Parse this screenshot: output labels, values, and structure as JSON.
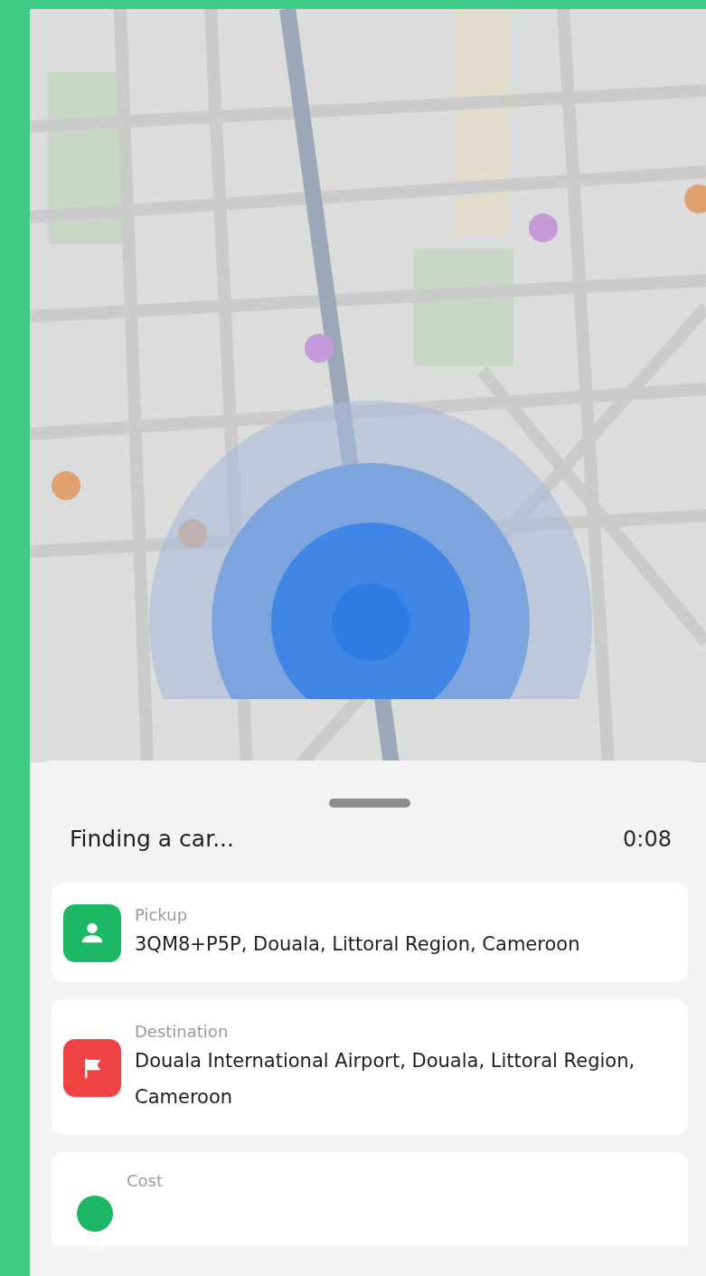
{
  "sheet": {
    "title": "Finding a car...",
    "timer": "0:08"
  },
  "locations": [
    {
      "kind": "pickup",
      "color": "#1db866",
      "label": "Pickup",
      "value": "3QM8+P5P, Douala, Littoral Region, Cameroon"
    },
    {
      "kind": "destination",
      "color": "#f04444",
      "label": "Destination",
      "value": "Douala International Airport, Douala, Littoral Region, Cameroon"
    },
    {
      "kind": "cost",
      "color": "#1db866",
      "label": "Cost"
    }
  ]
}
